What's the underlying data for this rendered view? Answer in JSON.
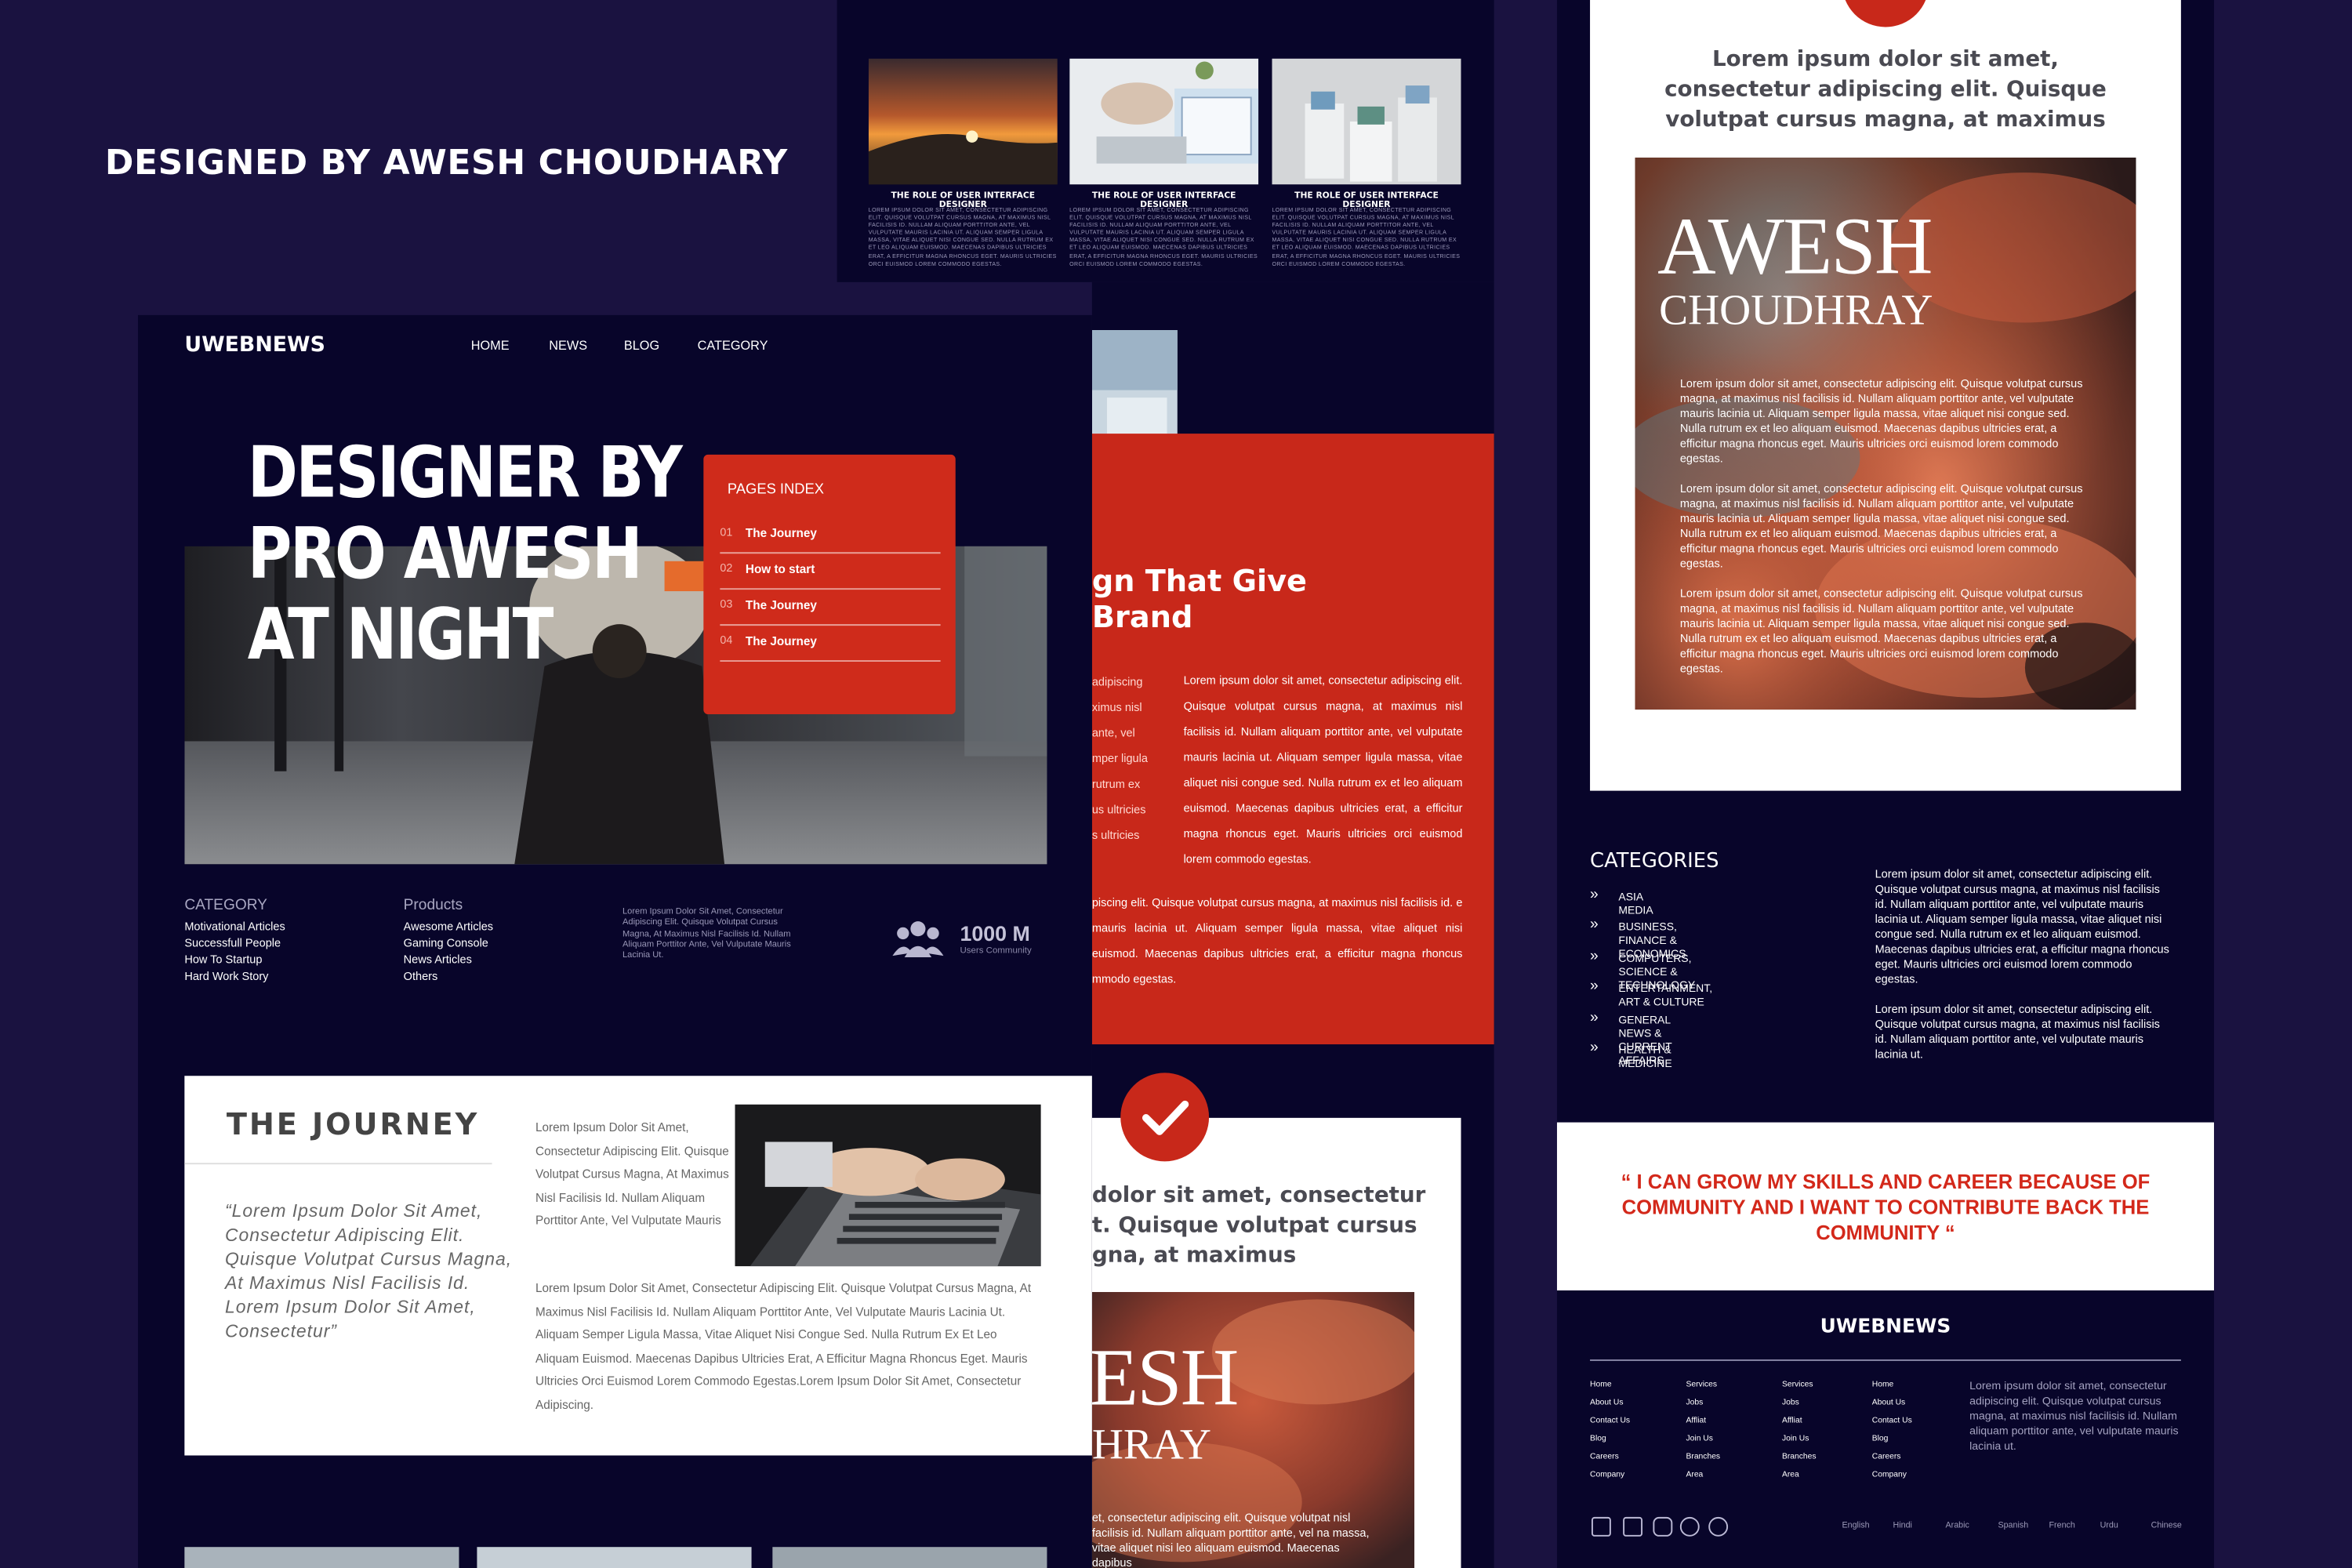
{
  "credit": "DESIGNED BY AWESH CHOUDHARY",
  "top_articles": [
    {
      "title": "THE ROLE OF USER INTERFACE DESIGNER",
      "text": "LOREM IPSUM DOLOR SIT AMET, CONSECTETUR ADIPISCING ELIT. QUISQUE VOLUTPAT CURSUS MAGNA, AT MAXIMUS NISL FACILISIS ID. NULLAM ALIQUAM PORTTITOR ANTE, VEL VULPUTATE MAURIS LACINIA UT. ALIQUAM SEMPER LIGULA MASSA, VITAE ALIQUET NISI CONGUE SED. NULLA RUTRUM EX ET LEO ALIQUAM EUISMOD. MAECENAS DAPIBUS ULTRICIES ERAT, A EFFICITUR MAGNA RHONCUS EGET. MAURIS ULTRICIES ORCI EUISMOD LOREM COMMODO EGESTAS."
    },
    {
      "title": "THE ROLE OF USER INTERFACE DESIGNER",
      "text": "LOREM IPSUM DOLOR SIT AMET, CONSECTETUR ADIPISCING ELIT. QUISQUE VOLUTPAT CURSUS MAGNA, AT MAXIMUS NISL FACILISIS ID. NULLAM ALIQUAM PORTTITOR ANTE, VEL VULPUTATE MAURIS LACINIA UT. ALIQUAM SEMPER LIGULA MASSA, VITAE ALIQUET NISI CONGUE SED. NULLA RUTRUM EX ET LEO ALIQUAM EUISMOD. MAECENAS DAPIBUS ULTRICIES ERAT, A EFFICITUR MAGNA RHONCUS EGET. MAURIS ULTRICIES ORCI EUISMOD LOREM COMMODO EGESTAS."
    },
    {
      "title": "THE ROLE OF USER INTERFACE DESIGNER",
      "text": "LOREM IPSUM DOLOR SIT AMET, CONSECTETUR ADIPISCING ELIT. QUISQUE VOLUTPAT CURSUS MAGNA, AT MAXIMUS NISL FACILISIS ID. NULLAM ALIQUAM PORTTITOR ANTE, VEL VULPUTATE MAURIS LACINIA UT. ALIQUAM SEMPER LIGULA MASSA, VITAE ALIQUET NISI CONGUE SED. NULLA RUTRUM EX ET LEO ALIQUAM EUISMOD. MAECENAS DAPIBUS ULTRICIES ERAT, A EFFICITUR MAGNA RHONCUS EGET. MAURIS ULTRICIES ORCI EUISMOD LOREM COMMODO EGESTAS."
    }
  ],
  "header": {
    "logo": "UWEBNEWS",
    "nav": [
      "HOME",
      "NEWS",
      "BLOG",
      "CATEGORY"
    ]
  },
  "hero": {
    "title_lines": [
      "DESIGNER BY",
      "PRO AWESH",
      "AT NIGHT"
    ]
  },
  "pages_index": {
    "title": "PAGES INDEX",
    "items": [
      {
        "num": "01",
        "label": "The Journey"
      },
      {
        "num": "02",
        "label": "How to start"
      },
      {
        "num": "03",
        "label": "The Journey"
      },
      {
        "num": "04",
        "label": "The Journey"
      }
    ]
  },
  "category_col": {
    "heading": "CATEGORY",
    "items": [
      "Motivational Articles",
      "Successfull People",
      "How To Startup",
      "Hard Work Story"
    ]
  },
  "products_col": {
    "heading": "Products",
    "items": [
      "Awesome Articles",
      "Gaming Console",
      "News Articles",
      "Others"
    ]
  },
  "small_blurb": "Lorem Ipsum Dolor Sit Amet, Consectetur Adipiscing Elit. Quisque Volutpat Cursus Magna, At Maximus Nisl Facilisis Id. Nullam Aliquam Porttitor Ante, Vel Vulputate Mauris Lacinia Ut.",
  "community": {
    "count": "1000 M",
    "label": "Users Community"
  },
  "journey": {
    "title": "THE JOURNEY",
    "quote": "“Lorem Ipsum Dolor Sit Amet, Consectetur Adipiscing Elit. Quisque Volutpat Cursus Magna, At Maximus Nisl Facilisis Id. Lorem Ipsum Dolor Sit Amet, Consectetur”",
    "side_text": "Lorem Ipsum Dolor Sit Amet, Consectetur Adipiscing Elit. Quisque Volutpat Cursus Magna, At Maximus Nisl Facilisis Id. Nullam Aliquam Porttitor Ante, Vel Vulputate Mauris",
    "body": "Lorem Ipsum Dolor Sit Amet, Consectetur Adipiscing Elit. Quisque Volutpat Cursus Magna, At Maximus Nisl Facilisis Id. Nullam Aliquam Porttitor Ante, Vel Vulputate Mauris Lacinia Ut. Aliquam Semper Ligula Massa, Vitae Aliquet Nisi Congue Sed. Nulla Rutrum Ex Et Leo Aliquam Euismod. Maecenas Dapibus Ultricies Erat, A Efficitur Magna Rhoncus Eget. Mauris Ultricies Orci Euismod Lorem Commodo Egestas.Lorem Ipsum Dolor Sit Amet, Consectetur Adipiscing."
  },
  "mid_red": {
    "heading_lines": [
      "gn That Give",
      "Brand"
    ],
    "left_fragments": [
      "adipiscing",
      "ximus nisl",
      "ante, vel",
      "mper ligula",
      "rutrum ex",
      "us ultricies",
      "s ultricies"
    ],
    "right_para": "Lorem ipsum dolor sit amet, consectetur adipiscing elit. Quisque volutpat cursus magna, at maximus nisl facilisis id. Nullam aliquam porttitor ante, vel vulputate mauris lacinia ut. Aliquam semper ligula massa, vitae aliquet nisi congue sed. Nulla rutrum ex et leo aliquam euismod. Maecenas dapibus ultricies erat, a efficitur magna rhoncus eget. Mauris ultricies orci euismod lorem commodo egestas.",
    "bottom_para": "piscing elit. Quisque volutpat cursus magna, at maximus nisl facilisis id. e mauris lacinia ut. Aliquam semper ligula massa, vitae aliquet nisi euismod. Maecenas dapibus ultricies erat, a efficitur magna rhoncus mmodo egestas."
  },
  "mid_white": {
    "text_lines": [
      "dolor sit amet, consectetur",
      "t. Quisque volutpat cursus",
      "gna, at maximus"
    ],
    "poster_lines": [
      "ESH",
      "HRAY"
    ],
    "poster_text": "et, consectetur adipiscing elit. Quisque volutpat nisl facilisis id. Nullam aliquam porttitor ante, vel na massa, vitae aliquet nisi leo aliquam euismod. Maecenas dapibus"
  },
  "right_card": {
    "lead": "Lorem ipsum dolor sit amet, consectetur adipiscing elit. Quisque volutpat cursus magna, at maximus",
    "poster_title": "AWESH",
    "poster_subtitle": "CHOUDHRAY",
    "poster_paras": [
      "Lorem ipsum dolor sit amet, consectetur adipiscing elit. Quisque volutpat cursus magna, at maximus nisl facilisis id. Nullam aliquam porttitor ante, vel vulputate mauris lacinia ut. Aliquam semper ligula massa, vitae aliquet nisi congue sed. Nulla rutrum ex et leo aliquam euismod. Maecenas dapibus ultricies erat, a efficitur magna rhoncus eget. Mauris ultricies orci euismod lorem commodo egestas.",
      "Lorem ipsum dolor sit amet, consectetur adipiscing elit. Quisque volutpat cursus magna, at maximus nisl facilisis id. Nullam aliquam porttitor ante, vel vulputate mauris lacinia ut. Aliquam semper ligula massa, vitae aliquet nisi congue sed. Nulla rutrum ex et leo aliquam euismod. Maecenas dapibus ultricies erat, a efficitur magna rhoncus eget. Mauris ultricies orci euismod lorem commodo egestas.",
      "Lorem ipsum dolor sit amet, consectetur adipiscing elit. Quisque volutpat cursus magna, at maximus nisl facilisis id. Nullam aliquam porttitor ante, vel vulputate mauris lacinia ut. Aliquam semper ligula massa, vitae aliquet nisi congue sed. Nulla rutrum ex et leo aliquam euismod. Maecenas dapibus ultricies erat, a efficitur magna rhoncus eget. Mauris ultricies orci euismod lorem commodo egestas."
    ]
  },
  "categories": {
    "heading": "CATEGORIES",
    "items": [
      "ASIA MEDIA",
      "BUSINESS, FINANCE & ECONOMICS",
      "COMPUTERS, SCIENCE & TECHNOLOGY",
      "ENTERTAINMENT, ART & CULTURE",
      "GENERAL NEWS & CURRENT AFFAIRS",
      "HEALTH & MEDICINE"
    ],
    "para1": "Lorem ipsum dolor sit amet, consectetur adipiscing elit. Quisque volutpat cursus magna, at maximus nisl facilisis id. Nullam aliquam porttitor ante, vel vulputate mauris lacinia ut. Aliquam semper ligula massa, vitae aliquet nisi congue sed. Nulla rutrum ex et leo aliquam euismod. Maecenas dapibus ultricies erat, a efficitur magna rhoncus eget. Mauris ultricies orci euismod lorem commodo egestas.",
    "para2": "Lorem ipsum dolor sit amet, consectetur adipiscing elit. Quisque volutpat cursus magna, at maximus nisl facilisis id. Nullam aliquam porttitor ante, vel vulputate mauris lacinia ut."
  },
  "quote": "“ I CAN GROW MY SKILLS AND CAREER BECAUSE OF COMMUNITY AND I WANT TO CONTRIBUTE BACK THE COMMUNITY “",
  "footer": {
    "logo": "UWEBNEWS",
    "columns": [
      [
        "Home",
        "About Us",
        "Contact Us",
        "Blog",
        "Careers",
        "Company"
      ],
      [
        "Services",
        "Jobs",
        "Affliat",
        "Join Us",
        "Branches",
        "Area"
      ],
      [
        "Services",
        "Jobs",
        "Affliat",
        "Join Us",
        "Branches",
        "Area"
      ],
      [
        "Home",
        "About Us",
        "Contact Us",
        "Blog",
        "Careers",
        "Company"
      ]
    ],
    "about": "Lorem ipsum dolor sit amet, consectetur adipiscing elit. Quisque volutpat cursus magna, at maximus nisl facilisis id. Nullam aliquam porttitor ante, vel vulputate mauris lacinia ut.",
    "languages": [
      "English",
      "Hindi",
      "Arabic",
      "Spanish",
      "French",
      "Urdu",
      "Chinese"
    ],
    "social_icons": [
      "twitter-icon",
      "facebook-icon",
      "instagram-icon",
      "dribbble-icon",
      "github-icon"
    ]
  },
  "colors": {
    "navy": "#08052a",
    "purple_bg": "#1a1240",
    "accent_red": "#cf2b1b"
  }
}
